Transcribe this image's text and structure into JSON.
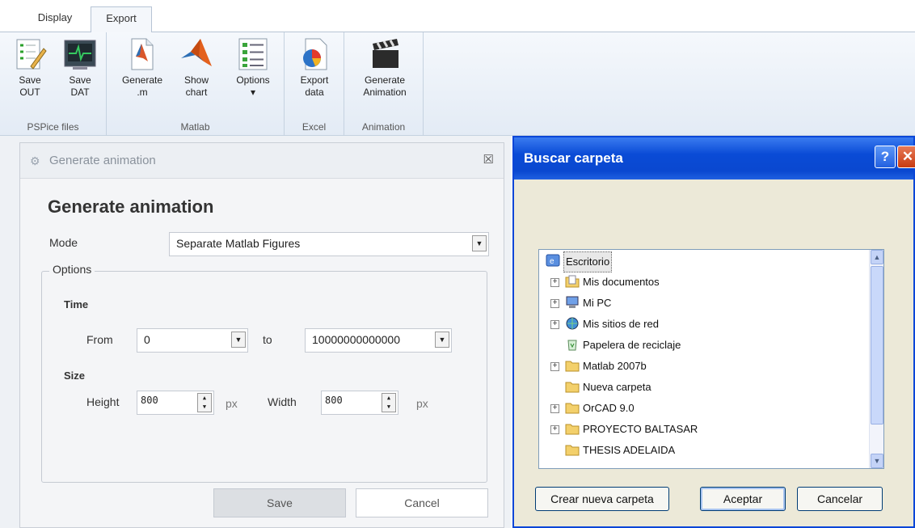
{
  "ribbon": {
    "tabs": [
      {
        "label": "Display"
      },
      {
        "label": "Export"
      }
    ],
    "groups": [
      {
        "title": "PSPice files",
        "buttons": [
          {
            "label": "Save\nOUT",
            "icon": "save-out-icon"
          },
          {
            "label": "Save\nDAT",
            "icon": "save-dat-icon"
          }
        ]
      },
      {
        "title": "Matlab",
        "buttons": [
          {
            "label": "Generate\n.m",
            "icon": "generate-m-icon"
          },
          {
            "label": "Show\nchart",
            "icon": "matlab-logo-icon"
          },
          {
            "label": "Options\n▾",
            "icon": "options-list-icon"
          }
        ]
      },
      {
        "title": "Excel",
        "buttons": [
          {
            "label": "Export\ndata",
            "icon": "excel-chart-icon"
          }
        ]
      },
      {
        "title": "Animation",
        "buttons": [
          {
            "label": "Generate\nAnimation",
            "icon": "clapperboard-icon"
          }
        ]
      }
    ]
  },
  "animation_panel": {
    "window_title": "Generate animation",
    "heading": "Generate animation",
    "mode_label": "Mode",
    "mode_value": "Separate Matlab Figures",
    "options_label": "Options",
    "time_label": "Time",
    "from_label": "From",
    "from_value": "0",
    "to_label": "to",
    "to_value": "10000000000000",
    "size_label": "Size",
    "height_label": "Height",
    "height_value": "800",
    "width_label": "Width",
    "width_value": "800",
    "unit": "px",
    "save_label": "Save",
    "cancel_label": "Cancel",
    "close_glyph": "☒"
  },
  "folder_dialog": {
    "title": "Buscar carpeta",
    "help_glyph": "?",
    "close_glyph": "✕",
    "tree": [
      {
        "label": "Escritorio",
        "expander": "",
        "icon": "desktop-icon",
        "selected": true
      },
      {
        "label": "Mis documentos",
        "expander": "+",
        "icon": "documents-folder-icon"
      },
      {
        "label": "Mi PC",
        "expander": "+",
        "icon": "computer-icon"
      },
      {
        "label": "Mis sitios de red",
        "expander": "+",
        "icon": "network-icon"
      },
      {
        "label": "Papelera de reciclaje",
        "expander": "",
        "icon": "recycle-bin-icon"
      },
      {
        "label": "Matlab 2007b",
        "expander": "+",
        "icon": "folder-icon"
      },
      {
        "label": "Nueva carpeta",
        "expander": "",
        "icon": "folder-icon"
      },
      {
        "label": "OrCAD 9.0",
        "expander": "+",
        "icon": "folder-icon"
      },
      {
        "label": "PROYECTO BALTASAR",
        "expander": "+",
        "icon": "folder-icon"
      },
      {
        "label": "THESIS ADELAIDA",
        "expander": "",
        "icon": "folder-icon"
      }
    ],
    "new_folder_label": "Crear nueva carpeta",
    "ok_label": "Aceptar",
    "cancel_label": "Cancelar"
  },
  "colors": {
    "xp_title_blue": "#0a4bd6",
    "xp_face": "#ece9d8",
    "panel_bg": "#f4f5f7",
    "folder_yellow": "#f3d06b"
  }
}
